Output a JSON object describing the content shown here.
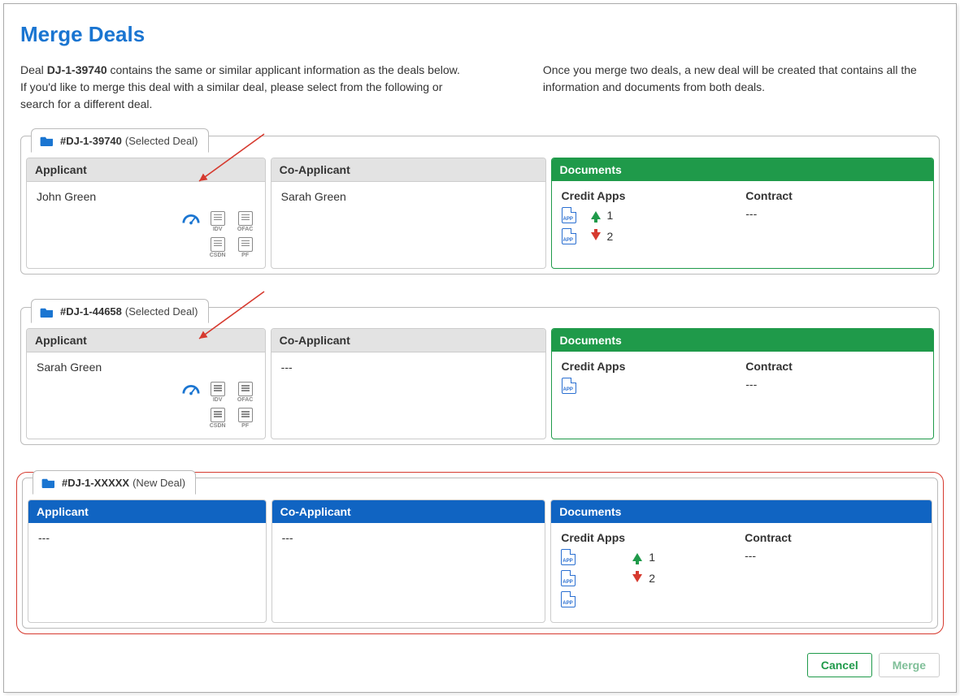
{
  "page": {
    "title": "Merge Deals",
    "intro_prefix": "Deal ",
    "intro_deal_id": "DJ-1-39740",
    "intro_suffix": " contains the same or similar applicant information as the deals below. If you'd like to merge this deal with a similar deal, please select from the following or search for a different deal.",
    "intro_right": "Once you merge two deals, a new deal will be created that contains all the information and documents from both deals."
  },
  "labels": {
    "applicant": "Applicant",
    "co_applicant": "Co-Applicant",
    "documents": "Documents",
    "credit_apps": "Credit Apps",
    "contract": "Contract",
    "empty": "---",
    "selected_deal": "(Selected Deal)",
    "new_deal": "(New Deal)"
  },
  "deals": [
    {
      "id": "#DJ-1-39740",
      "sub": "(Selected Deal)",
      "applicant": "John Green",
      "co_applicant": "Sarah Green",
      "docs_style": "green",
      "credit_apps": [
        {
          "dir": "up",
          "count": "1"
        },
        {
          "dir": "down",
          "count": "2"
        }
      ],
      "contract": "---",
      "show_icons": true
    },
    {
      "id": "#DJ-1-44658",
      "sub": "(Selected Deal)",
      "applicant": "Sarah Green",
      "co_applicant": "---",
      "docs_style": "green",
      "credit_apps": [
        {
          "dir": "none",
          "count": ""
        }
      ],
      "contract": "---",
      "show_icons": true
    },
    {
      "id": "#DJ-1-XXXXX",
      "sub": "(New Deal)",
      "applicant": "---",
      "co_applicant": "---",
      "docs_style": "blue",
      "credit_apps": [
        {
          "dir": "up",
          "count": "1",
          "extra_gap": true
        },
        {
          "dir": "down",
          "count": "2",
          "extra_gap": true
        },
        {
          "dir": "none",
          "count": ""
        }
      ],
      "contract": "---",
      "show_icons": false,
      "new_highlight": true
    }
  ],
  "actions": {
    "cancel": "Cancel",
    "merge": "Merge"
  },
  "icon_labels": {
    "idv": "IDV",
    "ofac": "OFAC",
    "csdn": "CSDN",
    "pf": "PF"
  }
}
